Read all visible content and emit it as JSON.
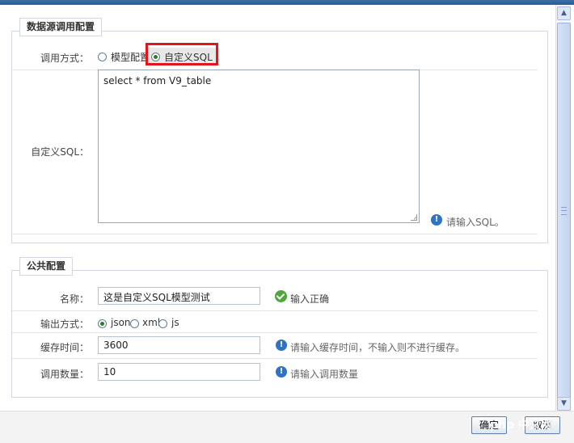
{
  "datasource": {
    "legend": "数据源调用配置",
    "call_mode_label": "调用方式：",
    "option_model": "模型配置",
    "option_custom": "自定义SQL",
    "custom_sql_label": "自定义SQL：",
    "sql_value": "select * from  V9_table",
    "sql_hint": "请输入SQL。"
  },
  "common": {
    "legend": "公共配置",
    "name_label": "名称：",
    "name_value": "这是自定义SQL模型测试",
    "name_status": "输入正确",
    "output_label": "输出方式：",
    "output_options": [
      "json",
      "xml",
      "js"
    ],
    "cache_label": "缓存时间：",
    "cache_value": "3600",
    "cache_hint": "请输入缓存时间，不输入则不进行缓存。",
    "count_label": "调用数量：",
    "count_value": "10",
    "count_hint": "请输入调用数量"
  },
  "footer": {
    "confirm": "确定",
    "cancel": "取消",
    "watermark": "php 中文网"
  }
}
